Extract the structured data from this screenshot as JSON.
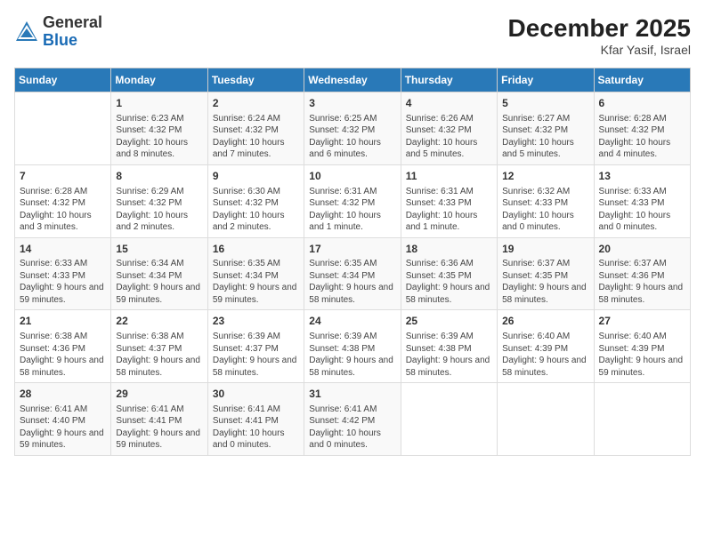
{
  "header": {
    "logo_general": "General",
    "logo_blue": "Blue",
    "month": "December 2025",
    "location": "Kfar Yasif, Israel"
  },
  "weekdays": [
    "Sunday",
    "Monday",
    "Tuesday",
    "Wednesday",
    "Thursday",
    "Friday",
    "Saturday"
  ],
  "weeks": [
    [
      {
        "day": "",
        "info": ""
      },
      {
        "day": "1",
        "info": "Sunrise: 6:23 AM\nSunset: 4:32 PM\nDaylight: 10 hours and 8 minutes."
      },
      {
        "day": "2",
        "info": "Sunrise: 6:24 AM\nSunset: 4:32 PM\nDaylight: 10 hours and 7 minutes."
      },
      {
        "day": "3",
        "info": "Sunrise: 6:25 AM\nSunset: 4:32 PM\nDaylight: 10 hours and 6 minutes."
      },
      {
        "day": "4",
        "info": "Sunrise: 6:26 AM\nSunset: 4:32 PM\nDaylight: 10 hours and 5 minutes."
      },
      {
        "day": "5",
        "info": "Sunrise: 6:27 AM\nSunset: 4:32 PM\nDaylight: 10 hours and 5 minutes."
      },
      {
        "day": "6",
        "info": "Sunrise: 6:28 AM\nSunset: 4:32 PM\nDaylight: 10 hours and 4 minutes."
      }
    ],
    [
      {
        "day": "7",
        "info": "Sunrise: 6:28 AM\nSunset: 4:32 PM\nDaylight: 10 hours and 3 minutes."
      },
      {
        "day": "8",
        "info": "Sunrise: 6:29 AM\nSunset: 4:32 PM\nDaylight: 10 hours and 2 minutes."
      },
      {
        "day": "9",
        "info": "Sunrise: 6:30 AM\nSunset: 4:32 PM\nDaylight: 10 hours and 2 minutes."
      },
      {
        "day": "10",
        "info": "Sunrise: 6:31 AM\nSunset: 4:32 PM\nDaylight: 10 hours and 1 minute."
      },
      {
        "day": "11",
        "info": "Sunrise: 6:31 AM\nSunset: 4:33 PM\nDaylight: 10 hours and 1 minute."
      },
      {
        "day": "12",
        "info": "Sunrise: 6:32 AM\nSunset: 4:33 PM\nDaylight: 10 hours and 0 minutes."
      },
      {
        "day": "13",
        "info": "Sunrise: 6:33 AM\nSunset: 4:33 PM\nDaylight: 10 hours and 0 minutes."
      }
    ],
    [
      {
        "day": "14",
        "info": "Sunrise: 6:33 AM\nSunset: 4:33 PM\nDaylight: 9 hours and 59 minutes."
      },
      {
        "day": "15",
        "info": "Sunrise: 6:34 AM\nSunset: 4:34 PM\nDaylight: 9 hours and 59 minutes."
      },
      {
        "day": "16",
        "info": "Sunrise: 6:35 AM\nSunset: 4:34 PM\nDaylight: 9 hours and 59 minutes."
      },
      {
        "day": "17",
        "info": "Sunrise: 6:35 AM\nSunset: 4:34 PM\nDaylight: 9 hours and 58 minutes."
      },
      {
        "day": "18",
        "info": "Sunrise: 6:36 AM\nSunset: 4:35 PM\nDaylight: 9 hours and 58 minutes."
      },
      {
        "day": "19",
        "info": "Sunrise: 6:37 AM\nSunset: 4:35 PM\nDaylight: 9 hours and 58 minutes."
      },
      {
        "day": "20",
        "info": "Sunrise: 6:37 AM\nSunset: 4:36 PM\nDaylight: 9 hours and 58 minutes."
      }
    ],
    [
      {
        "day": "21",
        "info": "Sunrise: 6:38 AM\nSunset: 4:36 PM\nDaylight: 9 hours and 58 minutes."
      },
      {
        "day": "22",
        "info": "Sunrise: 6:38 AM\nSunset: 4:37 PM\nDaylight: 9 hours and 58 minutes."
      },
      {
        "day": "23",
        "info": "Sunrise: 6:39 AM\nSunset: 4:37 PM\nDaylight: 9 hours and 58 minutes."
      },
      {
        "day": "24",
        "info": "Sunrise: 6:39 AM\nSunset: 4:38 PM\nDaylight: 9 hours and 58 minutes."
      },
      {
        "day": "25",
        "info": "Sunrise: 6:39 AM\nSunset: 4:38 PM\nDaylight: 9 hours and 58 minutes."
      },
      {
        "day": "26",
        "info": "Sunrise: 6:40 AM\nSunset: 4:39 PM\nDaylight: 9 hours and 58 minutes."
      },
      {
        "day": "27",
        "info": "Sunrise: 6:40 AM\nSunset: 4:39 PM\nDaylight: 9 hours and 59 minutes."
      }
    ],
    [
      {
        "day": "28",
        "info": "Sunrise: 6:41 AM\nSunset: 4:40 PM\nDaylight: 9 hours and 59 minutes."
      },
      {
        "day": "29",
        "info": "Sunrise: 6:41 AM\nSunset: 4:41 PM\nDaylight: 9 hours and 59 minutes."
      },
      {
        "day": "30",
        "info": "Sunrise: 6:41 AM\nSunset: 4:41 PM\nDaylight: 10 hours and 0 minutes."
      },
      {
        "day": "31",
        "info": "Sunrise: 6:41 AM\nSunset: 4:42 PM\nDaylight: 10 hours and 0 minutes."
      },
      {
        "day": "",
        "info": ""
      },
      {
        "day": "",
        "info": ""
      },
      {
        "day": "",
        "info": ""
      }
    ]
  ]
}
